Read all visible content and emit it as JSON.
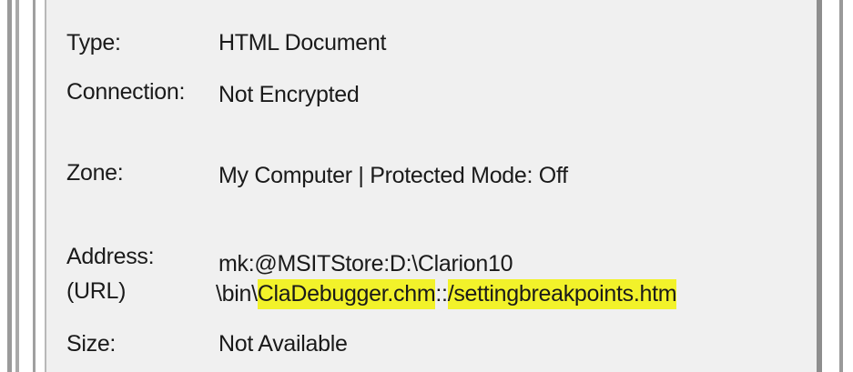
{
  "properties": {
    "type": {
      "label": "Type:",
      "value": "HTML Document"
    },
    "connection": {
      "label": "Connection:",
      "value": "Not Encrypted"
    },
    "zone": {
      "label": "Zone:",
      "value": "My Computer | Protected Mode: Off"
    },
    "address": {
      "label_line1": "Address:",
      "label_line2": "(URL)",
      "value_line1": "mk:@MSITStore:D:\\Clarion10",
      "value_line2_prefix": "\\bin\\",
      "value_line2_highlight1": "ClaDebugger.chm",
      "value_line2_sep": "::",
      "value_line2_highlight2": "/settingbreakpoints.htm"
    },
    "size": {
      "label": "Size:",
      "value": "Not Available"
    }
  },
  "colors": {
    "panel_background": "#f0f0f0",
    "highlight": "#f2f22a",
    "text": "#1a1a1a"
  }
}
